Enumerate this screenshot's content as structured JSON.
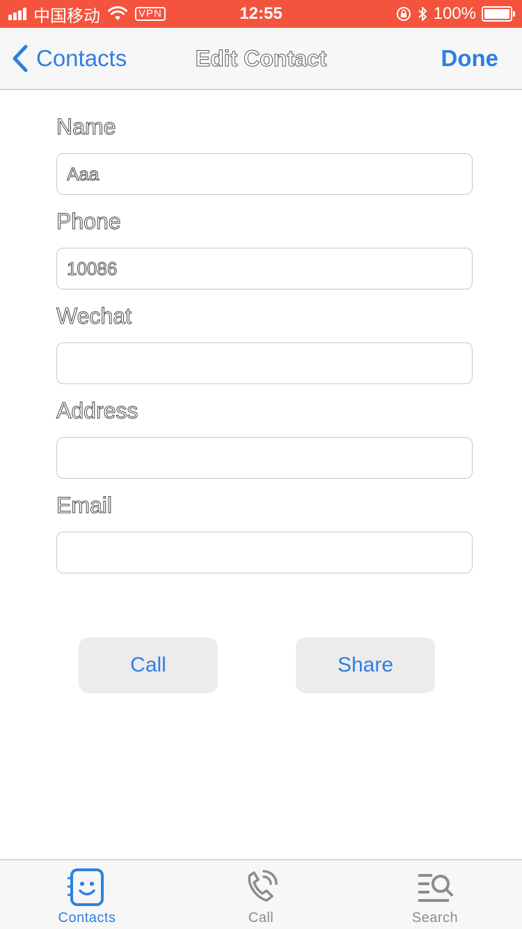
{
  "status_bar": {
    "carrier": "中国移动",
    "vpn": "VPN",
    "time": "12:55",
    "battery": "100%",
    "background_color": "#f4533d"
  },
  "nav": {
    "back_label": "Contacts",
    "title": "Edit Contact",
    "done_label": "Done",
    "accent_color": "#2f7fe0"
  },
  "form": {
    "fields": [
      {
        "label": "Name",
        "value": "Aaa"
      },
      {
        "label": "Phone",
        "value": "10086"
      },
      {
        "label": "Wechat",
        "value": ""
      },
      {
        "label": "Address",
        "value": ""
      },
      {
        "label": "Email",
        "value": ""
      }
    ]
  },
  "actions": {
    "call_label": "Call",
    "share_label": "Share"
  },
  "tabs": [
    {
      "label": "Contacts",
      "icon": "contacts-face-icon",
      "active": true
    },
    {
      "label": "Call",
      "icon": "phone-handset-icon",
      "active": false
    },
    {
      "label": "Search",
      "icon": "search-list-icon",
      "active": false
    }
  ]
}
